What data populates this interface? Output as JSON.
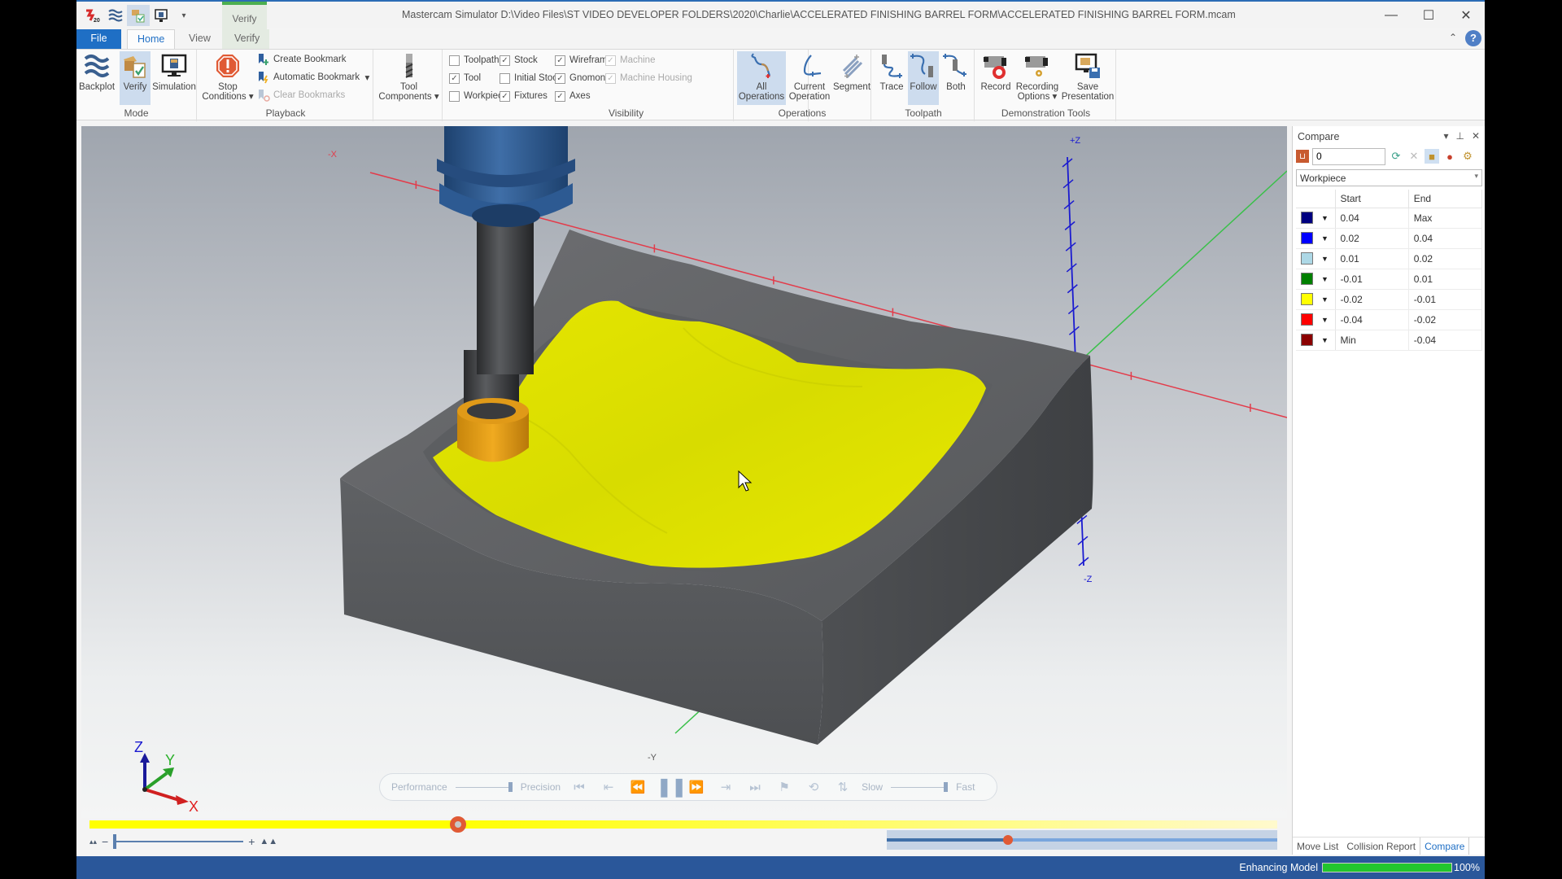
{
  "app": {
    "title": "Mastercam Simulator  D:\\Video Files\\ST VIDEO DEVELOPER FOLDERS\\2020\\Charlie\\ACCELERATED FINISHING BARREL FORM\\ACCELERATED FINISHING BARREL FORM.mcam",
    "context_tab_header": "Verify",
    "quick_access": [
      "mastercam-logo-icon",
      "backplot-icon",
      "verify-icon",
      "simulation-icon",
      "customize-dropdown-icon"
    ]
  },
  "tabs": [
    {
      "label": "File"
    },
    {
      "label": "Home",
      "active": true
    },
    {
      "label": "View"
    },
    {
      "label": "Verify"
    }
  ],
  "ribbon": {
    "mode": {
      "label": "Mode",
      "buttons": [
        {
          "label": "Backplot",
          "icon": "backplot-icon",
          "active": false
        },
        {
          "label": "Verify",
          "icon": "verify-icon",
          "active": true
        },
        {
          "label": "Simulation",
          "icon": "simulation-icon",
          "active": false
        }
      ]
    },
    "playback": {
      "label": "Playback",
      "stop_conditions_1": "Stop",
      "stop_conditions_2": "Conditions",
      "create_bookmark": "Create Bookmark",
      "automatic_bookmark": "Automatic Bookmark",
      "clear_bookmarks": "Clear Bookmarks"
    },
    "tool_components_1": "Tool",
    "tool_components_2": "Components",
    "visibility": {
      "label": "Visibility",
      "checkboxes": [
        {
          "label": "Toolpath",
          "checked": false,
          "enabled": true
        },
        {
          "label": "Tool",
          "checked": true,
          "enabled": true
        },
        {
          "label": "Workpiece",
          "checked": false,
          "enabled": true
        },
        {
          "label": "Stock",
          "checked": true,
          "enabled": true
        },
        {
          "label": "Initial Stock",
          "checked": false,
          "enabled": true
        },
        {
          "label": "Fixtures",
          "checked": true,
          "enabled": true
        },
        {
          "label": "Wireframe",
          "checked": true,
          "enabled": true
        },
        {
          "label": "Gnomon",
          "checked": true,
          "enabled": true
        },
        {
          "label": "Axes",
          "checked": true,
          "enabled": true
        },
        {
          "label": "Machine",
          "checked": true,
          "enabled": false
        },
        {
          "label": "Machine Housing",
          "checked": true,
          "enabled": false
        }
      ]
    },
    "operations": {
      "label": "Operations",
      "all_1": "All",
      "all_2": "Operations",
      "current_1": "Current",
      "current_2": "Operation",
      "segment": "Segment"
    },
    "toolpath": {
      "label": "Toolpath",
      "trace": "Trace",
      "follow": "Follow",
      "both": "Both"
    },
    "demo": {
      "label": "Demonstration Tools",
      "record": "Record",
      "rec_opts_1": "Recording",
      "rec_opts_2": "Options",
      "save_1": "Save",
      "save_2": "Presentation"
    }
  },
  "viewport": {
    "axis_labels": {
      "neg_x": "-X",
      "pos_z": "+Z",
      "neg_z": "-Z",
      "neg_y": "-Y"
    },
    "gnomon": {
      "x": "X",
      "y": "Y",
      "z": "Z"
    }
  },
  "playback": {
    "performance": "Performance",
    "precision": "Precision",
    "slow": "Slow",
    "fast": "Fast",
    "quality_value": 1.0,
    "speed_value": 1.0
  },
  "progress": {
    "simulation_fraction": 0.31,
    "timeline_fraction": 0.31,
    "zoom_fraction": 0.0
  },
  "compare_panel": {
    "title": "Compare",
    "tolerance_value": "0",
    "target": "Workpiece",
    "columns": [
      "",
      "Start",
      "End"
    ],
    "rows": [
      {
        "color": "#000080",
        "start": "0.04",
        "end": "Max"
      },
      {
        "color": "#0000ff",
        "start": "0.02",
        "end": "0.04"
      },
      {
        "color": "#add8e6",
        "start": "0.01",
        "end": "0.02"
      },
      {
        "color": "#008000",
        "start": "-0.01",
        "end": "0.01"
      },
      {
        "color": "#ffff00",
        "start": "-0.02",
        "end": "-0.01"
      },
      {
        "color": "#ff0000",
        "start": "-0.04",
        "end": "-0.02"
      },
      {
        "color": "#8b0000",
        "start": "Min",
        "end": "-0.04"
      }
    ],
    "bottom_tabs": [
      {
        "label": "Move List",
        "active": false
      },
      {
        "label": "Collision Report",
        "active": false
      },
      {
        "label": "Compare",
        "active": true
      }
    ]
  },
  "status": {
    "text": "Enhancing Model",
    "progress_pct": 100,
    "progress_label": "100%"
  }
}
